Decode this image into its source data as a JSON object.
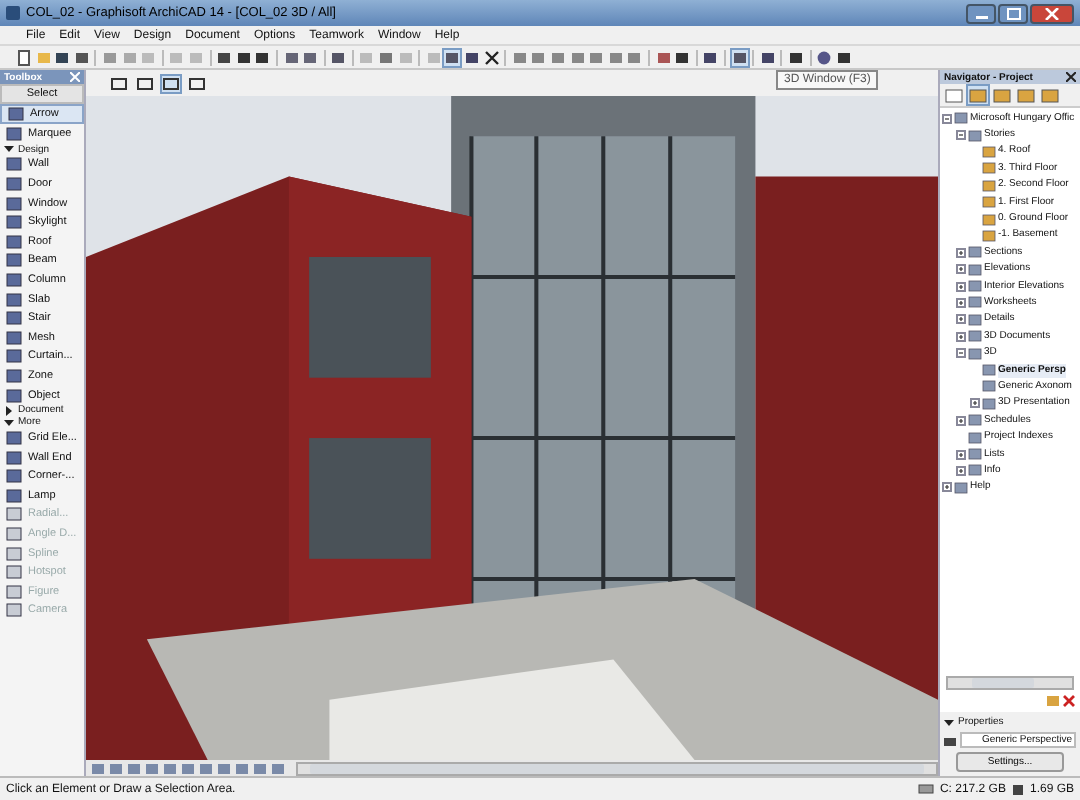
{
  "window": {
    "title": "COL_02 - Graphisoft ArchiCAD 14 - [COL_02 3D / All]"
  },
  "menu": [
    "File",
    "Edit",
    "View",
    "Design",
    "Document",
    "Options",
    "Teamwork",
    "Window",
    "Help"
  ],
  "tooltip": "3D Window (F3)",
  "toolbox": {
    "title": "Toolbox",
    "sections": [
      {
        "label": "Select",
        "kind": "header",
        "tools": [
          {
            "label": "Arrow",
            "selected": true,
            "disabled": false
          },
          {
            "label": "Marquee",
            "selected": false,
            "disabled": false
          }
        ]
      },
      {
        "label": "Design",
        "kind": "group",
        "expanded": true,
        "tools": [
          {
            "label": "Wall",
            "selected": false,
            "disabled": false
          },
          {
            "label": "Door",
            "selected": false,
            "disabled": false
          },
          {
            "label": "Window",
            "selected": false,
            "disabled": false
          },
          {
            "label": "Skylight",
            "selected": false,
            "disabled": false
          },
          {
            "label": "Roof",
            "selected": false,
            "disabled": false
          },
          {
            "label": "Beam",
            "selected": false,
            "disabled": false
          },
          {
            "label": "Column",
            "selected": false,
            "disabled": false
          },
          {
            "label": "Slab",
            "selected": false,
            "disabled": false
          },
          {
            "label": "Stair",
            "selected": false,
            "disabled": false
          },
          {
            "label": "Mesh",
            "selected": false,
            "disabled": false
          },
          {
            "label": "Curtain...",
            "selected": false,
            "disabled": false
          },
          {
            "label": "Zone",
            "selected": false,
            "disabled": false
          },
          {
            "label": "Object",
            "selected": false,
            "disabled": false
          }
        ]
      },
      {
        "label": "Document",
        "kind": "group",
        "expanded": false
      },
      {
        "label": "More",
        "kind": "group",
        "expanded": true,
        "tools": [
          {
            "label": "Grid Ele...",
            "selected": false,
            "disabled": false
          },
          {
            "label": "Wall End",
            "selected": false,
            "disabled": false
          },
          {
            "label": "Corner-...",
            "selected": false,
            "disabled": false
          },
          {
            "label": "Lamp",
            "selected": false,
            "disabled": false
          },
          {
            "label": "Radial...",
            "selected": false,
            "disabled": true
          },
          {
            "label": "Angle D...",
            "selected": false,
            "disabled": true
          },
          {
            "label": "Spline",
            "selected": false,
            "disabled": true
          },
          {
            "label": "Hotspot",
            "selected": false,
            "disabled": true
          },
          {
            "label": "Figure",
            "selected": false,
            "disabled": true
          },
          {
            "label": "Camera",
            "selected": false,
            "disabled": true
          }
        ]
      }
    ]
  },
  "navigator": {
    "title": "Navigator - Project",
    "tree": [
      {
        "label": "Microsoft Hungary Offic",
        "expanded": true,
        "selected": false,
        "children": [
          {
            "label": "Stories",
            "expanded": true,
            "selected": false,
            "children": [
              {
                "label": "4. Roof",
                "selected": false
              },
              {
                "label": "3. Third Floor",
                "selected": false
              },
              {
                "label": "2. Second Floor",
                "selected": false
              },
              {
                "label": "1. First Floor",
                "selected": false
              },
              {
                "label": "0. Ground Floor",
                "selected": false
              },
              {
                "label": "-1. Basement",
                "selected": false
              }
            ]
          },
          {
            "label": "Sections",
            "expanded": false,
            "selected": false
          },
          {
            "label": "Elevations",
            "expanded": false,
            "selected": false
          },
          {
            "label": "Interior Elevations",
            "expanded": false,
            "selected": false
          },
          {
            "label": "Worksheets",
            "expanded": false,
            "selected": false
          },
          {
            "label": "Details",
            "expanded": false,
            "selected": false
          },
          {
            "label": "3D Documents",
            "expanded": false,
            "selected": false
          },
          {
            "label": "3D",
            "expanded": true,
            "selected": false,
            "children": [
              {
                "label": "Generic Persp",
                "selected": true
              },
              {
                "label": "Generic Axonom",
                "selected": false
              },
              {
                "label": "3D Presentation",
                "expanded": false,
                "selected": false
              }
            ]
          },
          {
            "label": "Schedules",
            "expanded": false,
            "selected": false
          },
          {
            "label": "Project Indexes",
            "selected": false
          },
          {
            "label": "Lists",
            "expanded": false,
            "selected": false
          },
          {
            "label": "Info",
            "expanded": false,
            "selected": false
          }
        ]
      },
      {
        "label": "Help",
        "expanded": false,
        "selected": false
      }
    ],
    "properties": {
      "label": "Properties",
      "value": "Generic Perspective",
      "button": "Settings..."
    }
  },
  "status_bar": {
    "message": "Click an Element or Draw a Selection Area.",
    "disk": "C: 217.2 GB",
    "memory": "1.69 GB"
  }
}
